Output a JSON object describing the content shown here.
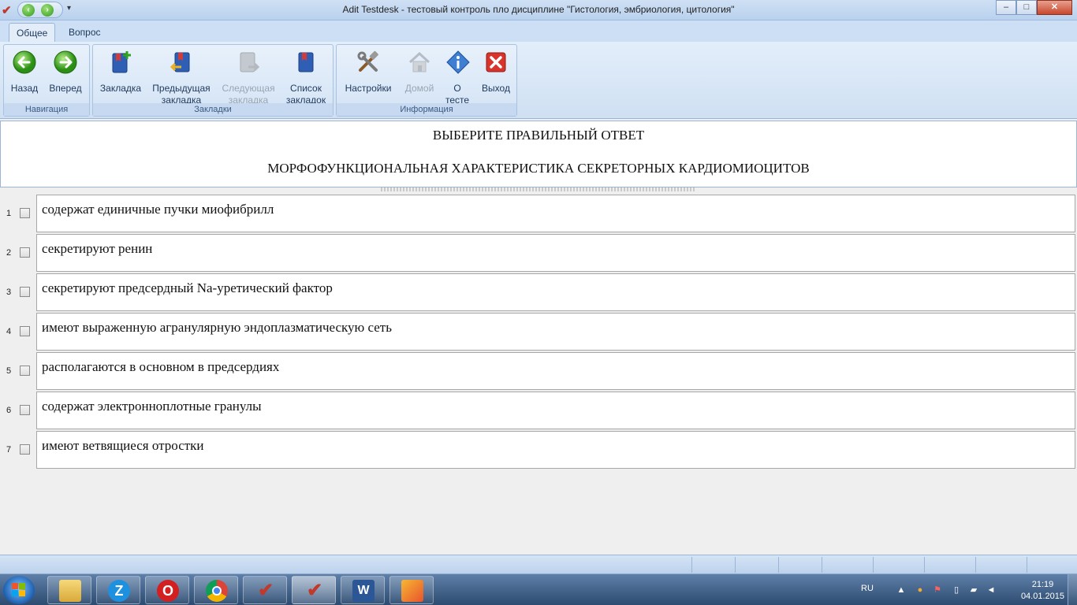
{
  "window": {
    "title": "Adit Testdesk - тестовый контроль пло дисциплине \"Гистология, эмбриология, цитология\"",
    "minimize_glyph": "–",
    "maximize_glyph": "□",
    "close_glyph": "✕"
  },
  "ribbon": {
    "tabs": [
      {
        "label": "Общее",
        "active": true
      },
      {
        "label": "Вопрос",
        "active": false
      }
    ],
    "groups": [
      {
        "label": "Навигация",
        "buttons": [
          {
            "label": "Назад",
            "icon": "back-arrow-icon",
            "enabled": true
          },
          {
            "label": "Вперед",
            "icon": "forward-arrow-icon",
            "enabled": true
          }
        ]
      },
      {
        "label": "Закладки",
        "buttons": [
          {
            "label": "Закладка",
            "icon": "bookmark-add-icon",
            "enabled": true
          },
          {
            "label_line1": "Предыдущая",
            "label_line2": "закладка",
            "icon": "bookmark-previous-icon",
            "enabled": true
          },
          {
            "label_line1": "Следующая",
            "label_line2": "закладка",
            "icon": "bookmark-next-icon",
            "enabled": false
          },
          {
            "label_line1": "Список",
            "label_line2": "закладок",
            "icon": "bookmark-list-icon",
            "enabled": true
          }
        ]
      },
      {
        "label": "Информация",
        "buttons": [
          {
            "label": "Настройки",
            "icon": "settings-tools-icon",
            "enabled": true
          },
          {
            "label": "Домой",
            "icon": "home-icon",
            "enabled": false
          },
          {
            "label_line1": "О",
            "label_line2": "тесте",
            "icon": "info-icon",
            "enabled": true
          },
          {
            "label": "Выход",
            "icon": "exit-icon",
            "enabled": true
          }
        ]
      }
    ]
  },
  "question": {
    "instruction": "ВЫБЕРИТЕ ПРАВИЛЬНЫЙ ОТВЕТ",
    "text": "МОРФОФУНКЦИОНАЛЬНАЯ ХАРАКТЕРИСТИКА СЕКРЕТОРНЫХ КАРДИОМИОЦИТОВ"
  },
  "answers": [
    {
      "number": "1",
      "text": "содержат единичные пучки миофибрилл",
      "checked": false
    },
    {
      "number": "2",
      "text": "секретируют ренин",
      "checked": false
    },
    {
      "number": "3",
      "text": "секретируют предсердный Na-уретический фактор",
      "checked": false
    },
    {
      "number": "4",
      "text": "имеют выраженную агранулярную эндоплазматическую сеть",
      "checked": false
    },
    {
      "number": "5",
      "text": "располагаются в основном в предсердиях",
      "checked": false
    },
    {
      "number": "6",
      "text": "содержат электронноплотные гранулы",
      "checked": false
    },
    {
      "number": "7",
      "text": "имеют ветвящиеся отростки",
      "checked": false
    }
  ],
  "taskbar": {
    "items": [
      "start-button",
      "explorer-icon",
      "zona-icon",
      "opera-icon",
      "chrome-icon",
      "testdesk-icon",
      "testdesk-icon",
      "word-icon",
      "paint-icon"
    ],
    "tray": {
      "language": "RU",
      "time": "21:19",
      "date": "04.01.2015"
    }
  },
  "colors": {
    "ribbon_bg": "#cfe0f3",
    "accent": "#1e395b",
    "disabled": "#9aa5b1"
  }
}
